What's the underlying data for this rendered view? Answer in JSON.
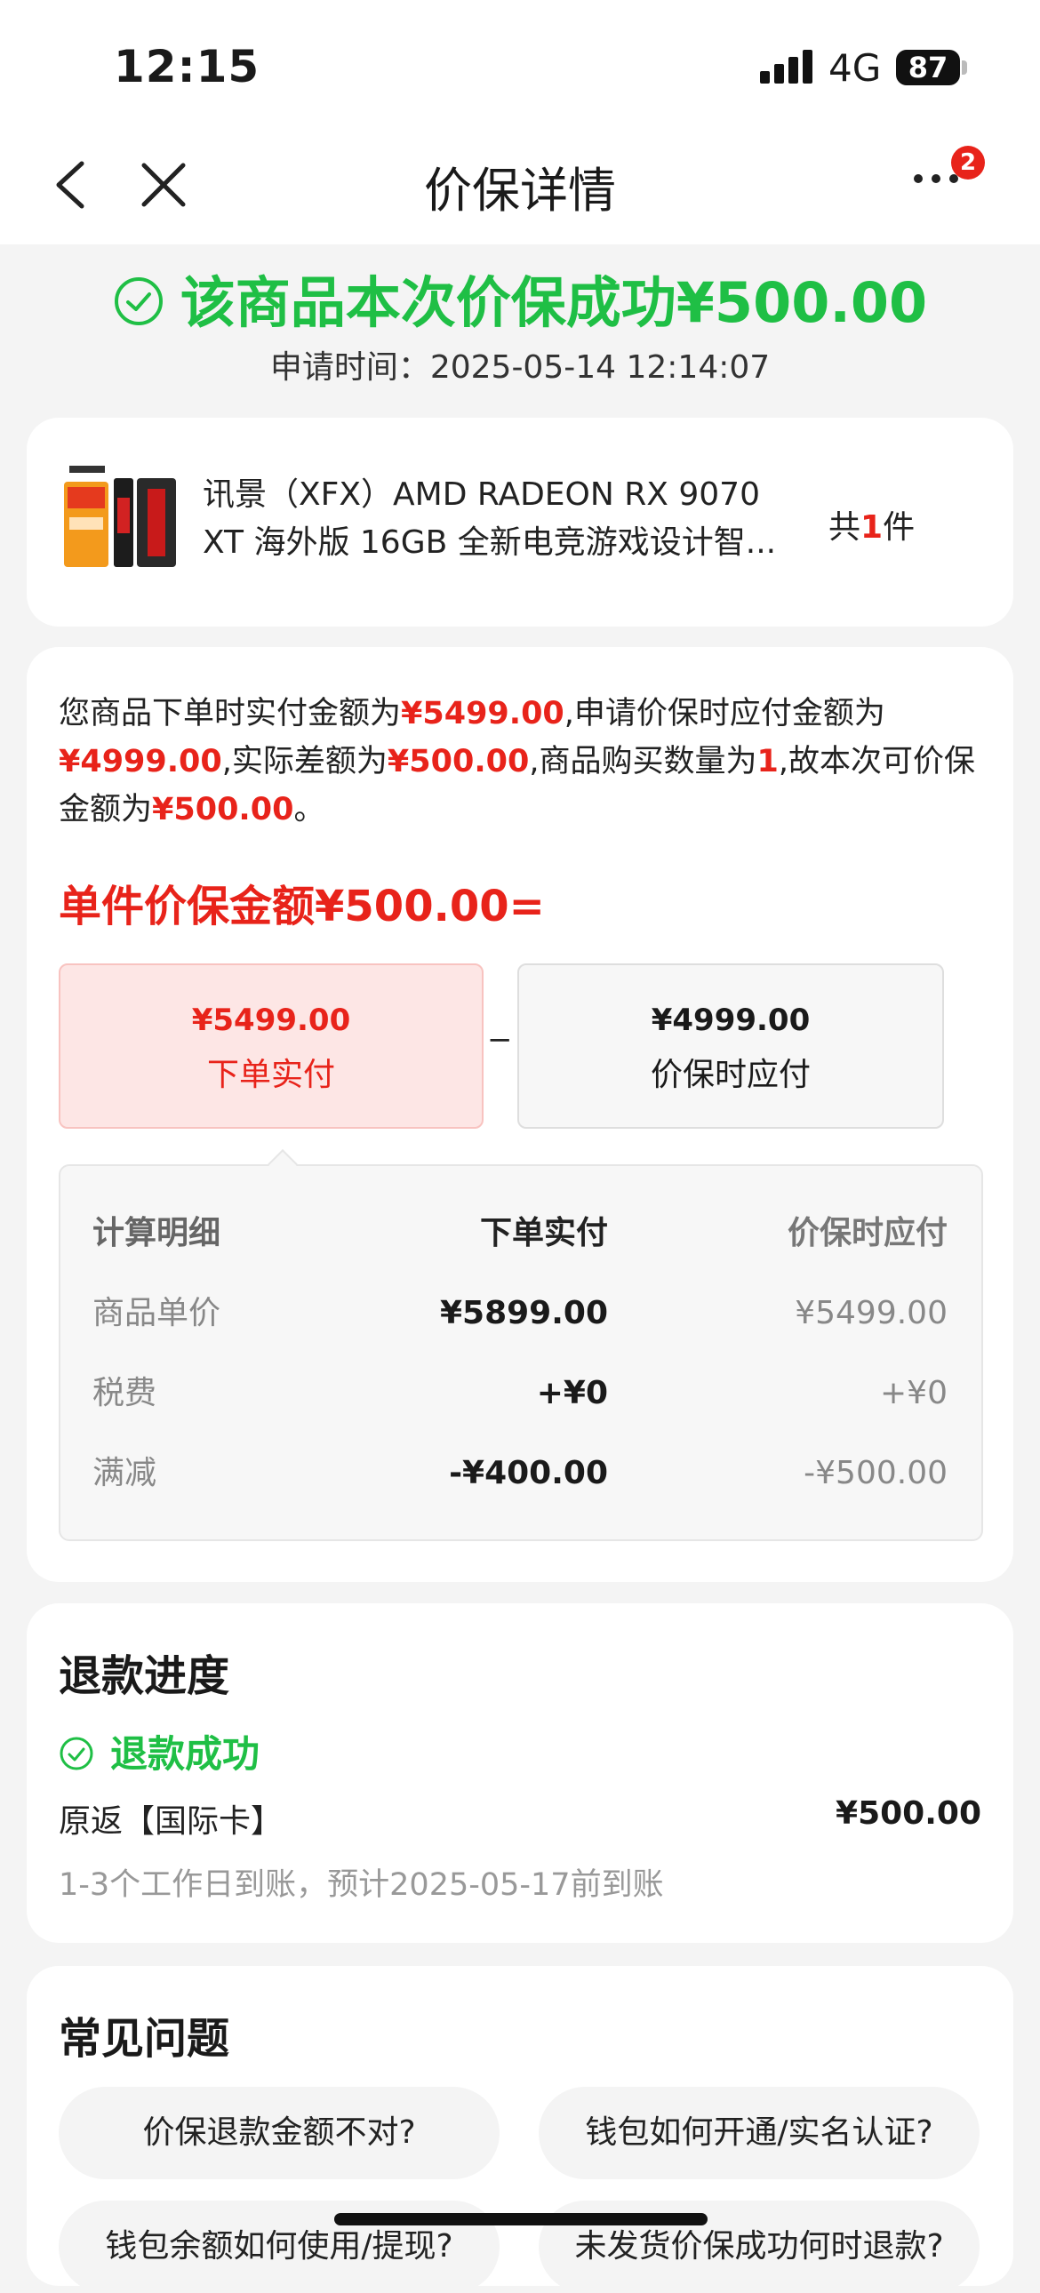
{
  "status_bar": {
    "time": "12:15",
    "network": "4G",
    "battery": "87"
  },
  "nav": {
    "title": "价保详情",
    "badge_count": "2"
  },
  "result": {
    "headline": "该商品本次价保成功¥500.00",
    "apply_time": "申请时间：2025-05-14 12:14:07"
  },
  "product": {
    "name": "讯景（XFX）AMD RADEON RX 9070 XT 海外版 16GB 全新电竞游戏设计智...",
    "qty_prefix": "共",
    "qty_value": "1",
    "qty_suffix": "件"
  },
  "calc": {
    "desc_parts": [
      "您商品下单时实付金额为",
      "¥5499.00",
      ",申请价保时应付金额为",
      "¥4999.00",
      ",实际差额为",
      "¥500.00",
      ",商品购买数量为",
      "1",
      ",故本次可价保金额为",
      "¥500.00",
      "。"
    ],
    "unit_title": "单件价保金额¥500.00=",
    "paid_value": "¥5499.00",
    "paid_label": "下单实付",
    "minus": "−",
    "due_value": "¥4999.00",
    "due_label": "价保时应付",
    "detail_headers": [
      "计算明细",
      "下单实付",
      "价保时应付"
    ],
    "detail_rows": [
      [
        "商品单价",
        "¥5899.00",
        "¥5499.00"
      ],
      [
        "税费",
        "+¥0",
        "+¥0"
      ],
      [
        "满减",
        "-¥400.00",
        "-¥500.00"
      ]
    ]
  },
  "refund": {
    "title": "退款进度",
    "status": "退款成功",
    "method": "原返【国际卡】",
    "amount": "¥500.00",
    "note": "1-3个工作日到账，预计2025-05-17前到账"
  },
  "faq": {
    "title": "常见问题",
    "items": [
      "价保退款金额不对?",
      "钱包如何开通/实名认证?",
      "钱包余额如何使用/提现?",
      "未发货价保成功何时退款?"
    ]
  },
  "colors": {
    "green": "#1fbf45",
    "red": "#e8231a"
  }
}
